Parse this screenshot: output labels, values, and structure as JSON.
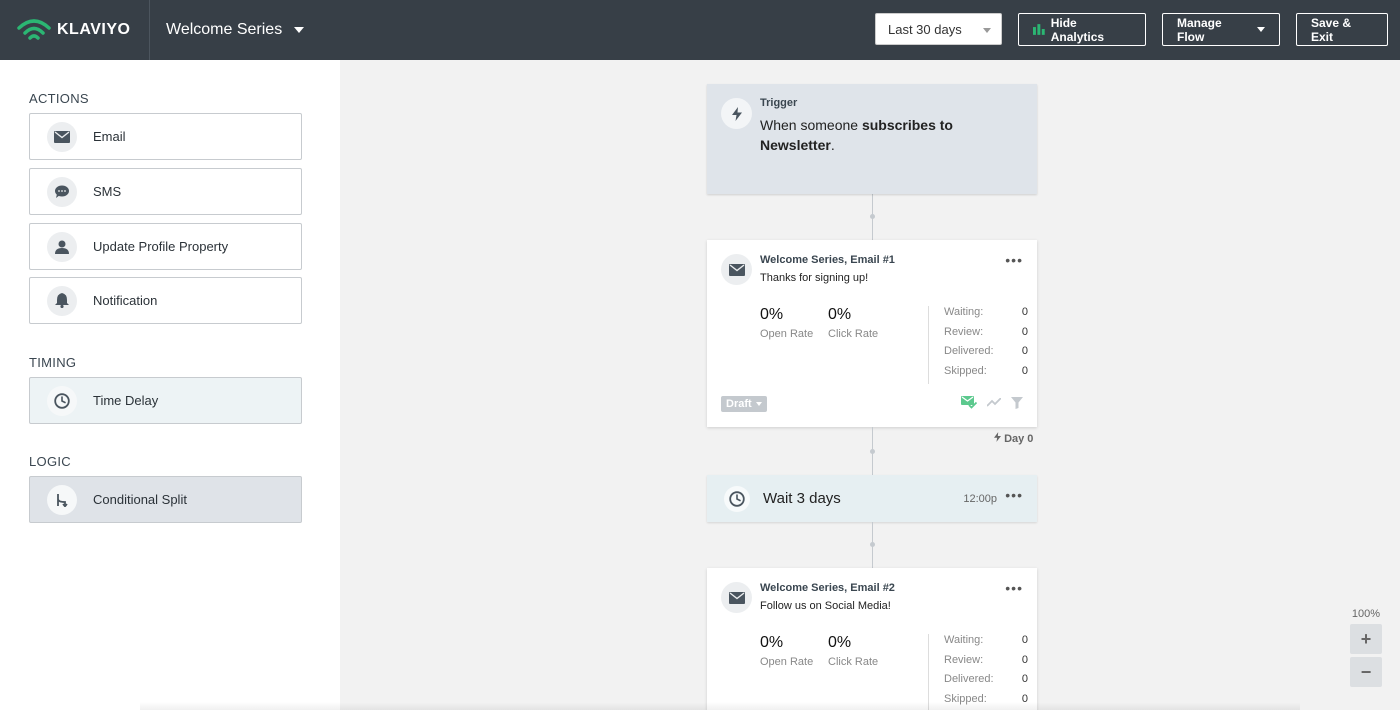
{
  "header": {
    "brand": "KLAVIYO",
    "flow_name": "Welcome Series",
    "date_range": "Last 30 days",
    "hide_analytics": "Hide Analytics",
    "manage_flow": "Manage Flow",
    "save_exit": "Save & Exit"
  },
  "sidebar": {
    "actions_title": "ACTIONS",
    "actions": [
      {
        "label": "Email",
        "icon": "envelope-icon"
      },
      {
        "label": "SMS",
        "icon": "chat-bubble-icon"
      },
      {
        "label": "Update Profile Property",
        "icon": "person-icon"
      },
      {
        "label": "Notification",
        "icon": "bell-icon"
      }
    ],
    "timing_title": "TIMING",
    "timing": {
      "label": "Time Delay",
      "icon": "clock-icon"
    },
    "logic_title": "LOGIC",
    "logic": {
      "label": "Conditional Split",
      "icon": "split-icon"
    }
  },
  "flow": {
    "trigger": {
      "label": "Trigger",
      "text_prefix": "When someone ",
      "text_bold": "subscribes to Newsletter",
      "text_suffix": "."
    },
    "email1": {
      "name": "Welcome Series, Email #1",
      "subject": "Thanks for signing up!",
      "open_rate": "0%",
      "open_rate_label": "Open Rate",
      "click_rate": "0%",
      "click_rate_label": "Click Rate",
      "stats": [
        {
          "label": "Waiting:",
          "value": "0"
        },
        {
          "label": "Review:",
          "value": "0"
        },
        {
          "label": "Delivered:",
          "value": "0"
        },
        {
          "label": "Skipped:",
          "value": "0"
        }
      ],
      "status": "Draft",
      "day_label": "Day 0"
    },
    "wait": {
      "label": "Wait 3 days",
      "time": "12:00p"
    },
    "email2": {
      "name": "Welcome Series, Email #2",
      "subject": "Follow us on Social Media!",
      "open_rate": "0%",
      "open_rate_label": "Open Rate",
      "click_rate": "0%",
      "click_rate_label": "Click Rate",
      "stats": [
        {
          "label": "Waiting:",
          "value": "0"
        },
        {
          "label": "Review:",
          "value": "0"
        },
        {
          "label": "Delivered:",
          "value": "0"
        },
        {
          "label": "Skipped:",
          "value": "0"
        }
      ]
    }
  },
  "zoom": {
    "level": "100%",
    "plus": "+",
    "minus": "−"
  },
  "colors": {
    "topbar": "#373f47",
    "brand_green": "#2bb673"
  }
}
